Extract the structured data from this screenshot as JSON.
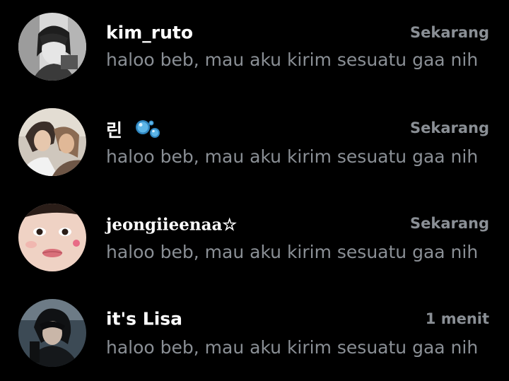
{
  "chats": [
    {
      "name": "kim_ruto",
      "time": "Sekarang",
      "message": "haloo beb, mau aku kirim sesuatu gaa nih",
      "avatar": "photo-bw-person"
    },
    {
      "name": "린",
      "name_icon": "bubbles-icon",
      "time": "Sekarang",
      "message": "haloo beb, mau aku kirim sesuatu gaa nih",
      "avatar": "photo-couple"
    },
    {
      "name": "jeongiieenaa☆",
      "time": "Sekarang",
      "message": "haloo beb, mau aku kirim sesuatu gaa nih",
      "avatar": "photo-face-closeup"
    },
    {
      "name": "it's Lisa",
      "time": "1 menit",
      "message": "haloo beb, mau aku kirim sesuatu gaa nih",
      "avatar": "photo-dark-person"
    }
  ],
  "colors": {
    "background": "#000000",
    "name": "#ffffff",
    "secondary": "#8a8f95",
    "bubble": "#4aa3d9"
  }
}
